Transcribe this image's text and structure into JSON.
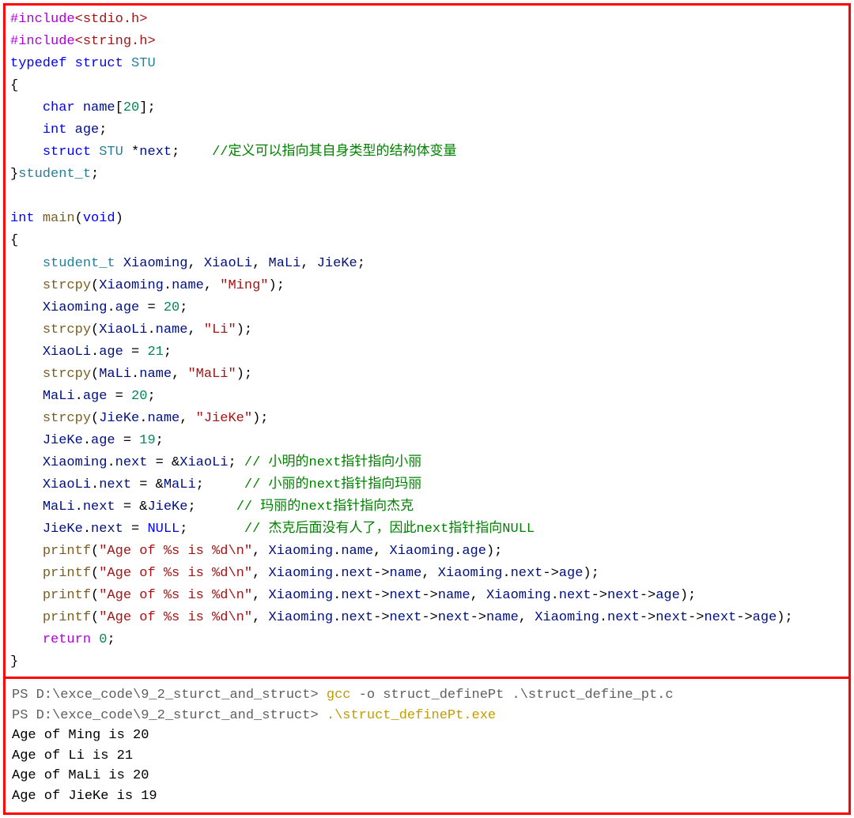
{
  "code": {
    "l1a": "#include",
    "l1b": "<stdio.h>",
    "l2a": "#include",
    "l2b": "<string.h>",
    "l3a": "typedef",
    "l3b": "struct",
    "l3c": "STU",
    "l4": "{",
    "l5a": "char",
    "l5b": "name",
    "l5c": "[",
    "l5d": "20",
    "l5e": "];",
    "l6a": "int",
    "l6b": "age",
    "l6c": ";",
    "l7a": "struct",
    "l7b": "STU",
    "l7c": "*",
    "l7d": "next",
    "l7e": ";",
    "l7cmt": "//定义可以指向其自身类型的结构体变量",
    "l8a": "}",
    "l8b": "student_t",
    "l8c": ";",
    "l9": "",
    "l10a": "int",
    "l10b": "main",
    "l10c": "(",
    "l10d": "void",
    "l10e": ")",
    "l11": "{",
    "l12a": "student_t",
    "l12b": "Xiaoming",
    "l12c": ", ",
    "l12d": "XiaoLi",
    "l12e": ", ",
    "l12f": "MaLi",
    "l12g": ", ",
    "l12h": "JieKe",
    "l12i": ";",
    "l13a": "strcpy",
    "l13b": "(",
    "l13c": "Xiaoming",
    "l13d": ".",
    "l13e": "name",
    "l13f": ", ",
    "l13g": "\"Ming\"",
    "l13h": ");",
    "l14a": "Xiaoming",
    "l14b": ".",
    "l14c": "age",
    "l14d": " = ",
    "l14e": "20",
    "l14f": ";",
    "l15a": "strcpy",
    "l15b": "(",
    "l15c": "XiaoLi",
    "l15d": ".",
    "l15e": "name",
    "l15f": ", ",
    "l15g": "\"Li\"",
    "l15h": ");",
    "l16a": "XiaoLi",
    "l16b": ".",
    "l16c": "age",
    "l16d": " = ",
    "l16e": "21",
    "l16f": ";",
    "l17a": "strcpy",
    "l17b": "(",
    "l17c": "MaLi",
    "l17d": ".",
    "l17e": "name",
    "l17f": ", ",
    "l17g": "\"MaLi\"",
    "l17h": ");",
    "l18a": "MaLi",
    "l18b": ".",
    "l18c": "age",
    "l18d": " = ",
    "l18e": "20",
    "l18f": ";",
    "l19a": "strcpy",
    "l19b": "(",
    "l19c": "JieKe",
    "l19d": ".",
    "l19e": "name",
    "l19f": ", ",
    "l19g": "\"JieKe\"",
    "l19h": ");",
    "l20a": "JieKe",
    "l20b": ".",
    "l20c": "age",
    "l20d": " = ",
    "l20e": "19",
    "l20f": ";",
    "l21a": "Xiaoming",
    "l21b": ".",
    "l21c": "next",
    "l21d": " = &",
    "l21e": "XiaoLi",
    "l21f": ";",
    "l21cmt": "// 小明的next指针指向小丽",
    "l22a": "XiaoLi",
    "l22b": ".",
    "l22c": "next",
    "l22d": " = &",
    "l22e": "MaLi",
    "l22f": ";",
    "l22cmt": "// 小丽的next指针指向玛丽",
    "l23a": "MaLi",
    "l23b": ".",
    "l23c": "next",
    "l23d": " = &",
    "l23e": "JieKe",
    "l23f": ";",
    "l23cmt": "// 玛丽的next指针指向杰克",
    "l24a": "JieKe",
    "l24b": ".",
    "l24c": "next",
    "l24d": " = ",
    "l24e": "NULL",
    "l24f": ";",
    "l24cmt": "// 杰克后面没有人了，因此next指针指向NULL",
    "l25a": "printf",
    "l25b": "(",
    "l25c": "\"Age of %s is %d\\n\"",
    "l25d": ", ",
    "l25e": "Xiaoming",
    "l25f": ".",
    "l25g": "name",
    "l25h": ", ",
    "l25i": "Xiaoming",
    "l25j": ".",
    "l25k": "age",
    "l25l": ");",
    "l26a": "printf",
    "l26b": "(",
    "l26c": "\"Age of %s is %d\\n\"",
    "l26d": ", ",
    "l26e": "Xiaoming",
    "l26f": ".",
    "l26g": "next",
    "l26h": "->",
    "l26i": "name",
    "l26j": ", ",
    "l26k": "Xiaoming",
    "l26l": ".",
    "l26m": "next",
    "l26n": "->",
    "l26o": "age",
    "l26p": ");",
    "l27a": "printf",
    "l27b": "(",
    "l27c": "\"Age of %s is %d\\n\"",
    "l27d": ", ",
    "l27e": "Xiaoming",
    "l27f": ".",
    "l27g": "next",
    "l27h": "->",
    "l27i": "next",
    "l27j": "->",
    "l27k": "name",
    "l27l": ", ",
    "l27m": "Xiaoming",
    "l27n": ".",
    "l27o": "next",
    "l27p": "->",
    "l27q": "next",
    "l27r": "->",
    "l27s": "age",
    "l27t": ");",
    "l28a": "printf",
    "l28b": "(",
    "l28c": "\"Age of %s is %d\\n\"",
    "l28d": ", ",
    "l28e": "Xiaoming",
    "l28f": ".",
    "l28g": "next",
    "l28h": "->",
    "l28i": "next",
    "l28j": "->",
    "l28k": "next",
    "l28l": "->",
    "l28m": "name",
    "l28n": ", ",
    "l28o": "Xiaoming",
    "l28p": ".",
    "l28q": "next",
    "l28r": "->",
    "l28s": "next",
    "l28t": "->",
    "l28u": "next",
    "l28v": "->",
    "l28w": "age",
    "l28x": ");",
    "l29a": "return",
    "l29b": "0",
    "l29c": ";",
    "l30": "}"
  },
  "term": {
    "p1a": "PS D:\\exce_code\\9_2_sturct_and_struct> ",
    "p1b": "gcc",
    "p1c": " -o struct_definePt .\\struct_define_pt.c",
    "p2a": "PS D:\\exce_code\\9_2_sturct_and_struct> ",
    "p2b": ".\\struct_definePt.exe",
    "o1": "Age of Ming is 20",
    "o2": "Age of Li is 21",
    "o3": "Age of MaLi is 20",
    "o4": "Age of JieKe is 19"
  }
}
